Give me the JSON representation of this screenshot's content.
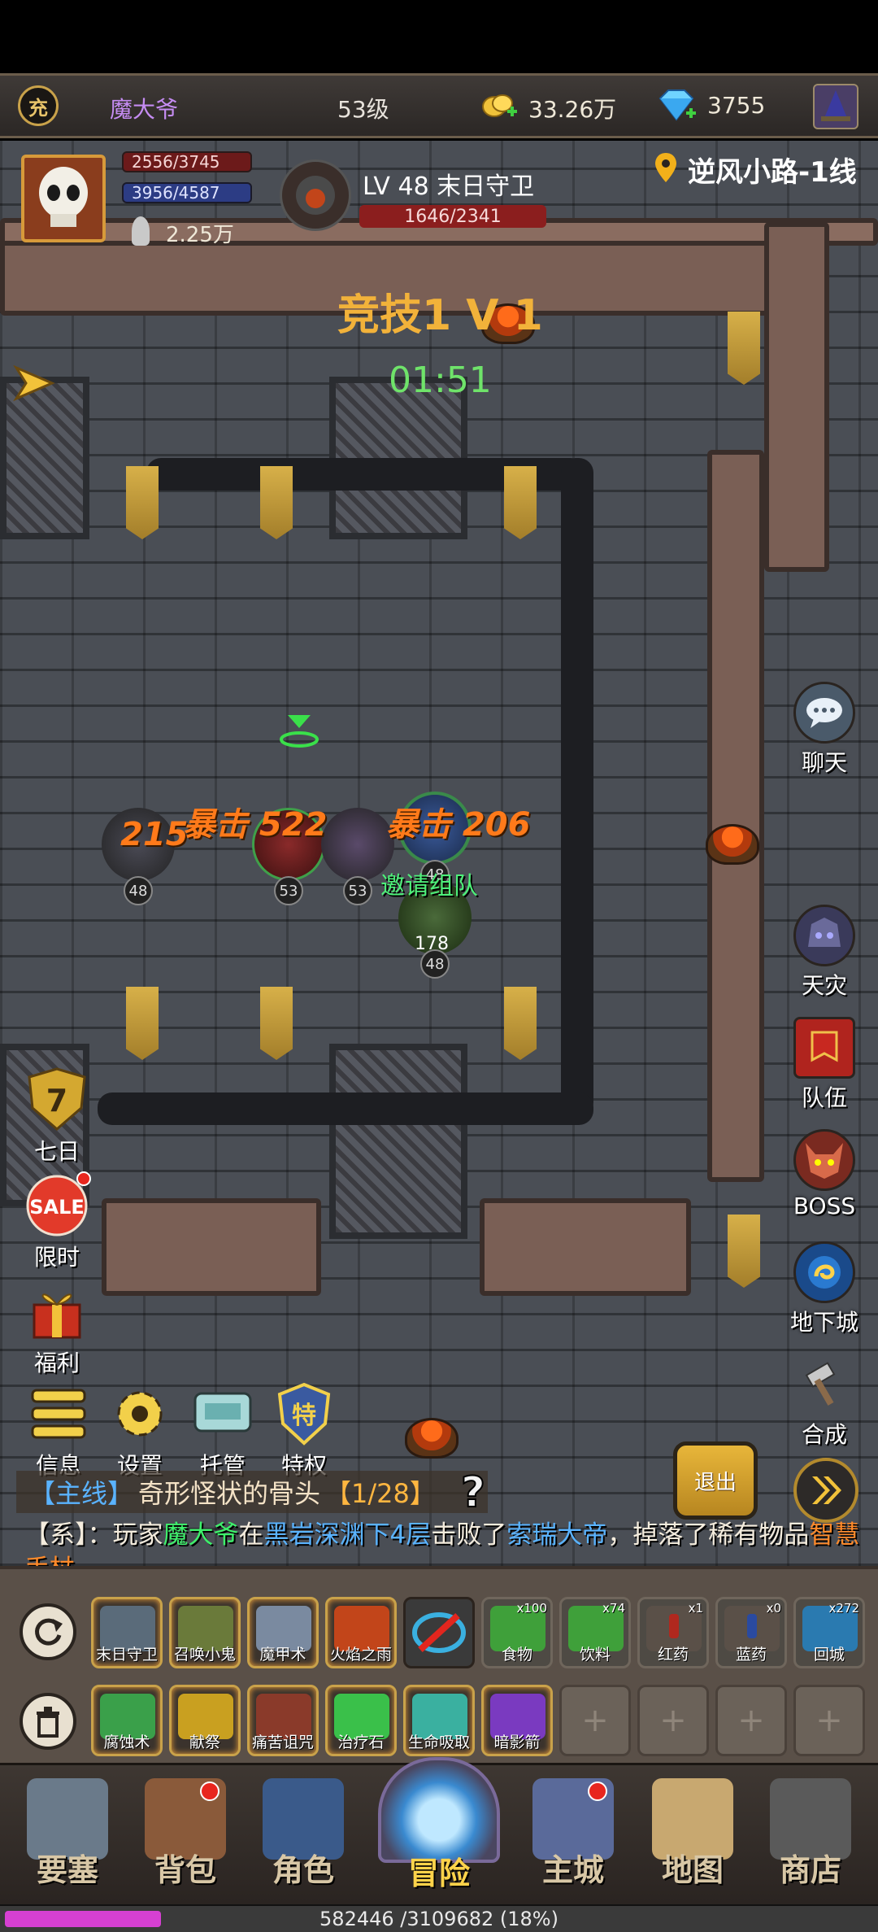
{
  "topbar": {
    "recharge_label": "充",
    "player_name": "魔大爷",
    "player_level": "53级",
    "gold": "33.26万",
    "gems": "3755"
  },
  "player": {
    "hp": "2556/3745",
    "mp": "3956/4587",
    "power": "2.25万"
  },
  "target": {
    "name": "LV 48 末日守卫",
    "hp": "1646/2341"
  },
  "location": "逆风小路-1线",
  "arena": {
    "title": "竞技1 V 1",
    "timer": "01:51",
    "invite": "邀请组队",
    "damage": [
      "215",
      "暴击 522",
      "暴击 206"
    ],
    "unit_levels": [
      "48",
      "53",
      "53",
      "48",
      "48"
    ],
    "enemy_hp_small": "178"
  },
  "right_buttons": [
    {
      "label": "聊天",
      "icon": "chat-icon"
    },
    {
      "label": "天灾",
      "icon": "skull-helm-icon"
    },
    {
      "label": "队伍",
      "icon": "team-flag-icon"
    },
    {
      "label": "BOSS",
      "icon": "demon-icon"
    },
    {
      "label": "地下城",
      "icon": "portal-icon"
    },
    {
      "label": "合成",
      "icon": "hammer-icon"
    }
  ],
  "left_buttons": [
    {
      "label": "七日",
      "icon": "seven-day-badge-icon",
      "badge": "7"
    },
    {
      "label": "限时",
      "icon": "sale-icon",
      "badge": "SALE"
    },
    {
      "label": "福利",
      "icon": "gift-icon"
    }
  ],
  "tools": [
    {
      "label": "信息",
      "icon": "menu-icon"
    },
    {
      "label": "设置",
      "icon": "gear-icon"
    },
    {
      "label": "托管",
      "icon": "auto-icon"
    },
    {
      "label": "特权",
      "icon": "privilege-icon",
      "badge": "特"
    }
  ],
  "quest": {
    "tag": "【主线】",
    "text": "奇形怪状的骨头",
    "progress": "【1/28】"
  },
  "system_message": {
    "prefix": "【系】：玩家",
    "player": "魔大爷",
    "at": "在",
    "place": "黑岩深渊下4层",
    "defeated": "击败了",
    "boss": "索瑞大帝",
    "dropped": "，掉落了稀有物品",
    "item": "智慧手杖"
  },
  "exit_label": "退出",
  "skills_row1": [
    {
      "label": "末日守卫",
      "color": "#5a6b7a"
    },
    {
      "label": "召唤小鬼",
      "color": "#6a7a3a"
    },
    {
      "label": "魔甲术",
      "color": "#7a8aa0"
    },
    {
      "label": "火焰之雨",
      "color": "#c2451a"
    }
  ],
  "items_row1": [
    {
      "label": "食物",
      "count": "x100",
      "color": "#3fa03a"
    },
    {
      "label": "饮料",
      "count": "x74",
      "color": "#3fa03a"
    },
    {
      "label": "红药",
      "count": "x1",
      "color": "#b0281e"
    },
    {
      "label": "蓝药",
      "count": "x0",
      "color": "#2a4aa0"
    },
    {
      "label": "回城",
      "count": "x272",
      "color": "#2a7ab0"
    }
  ],
  "skills_row2": [
    {
      "label": "腐蚀术",
      "color": "#3aa04a"
    },
    {
      "label": "献祭",
      "color": "#c9a020"
    },
    {
      "label": "痛苦诅咒",
      "color": "#8a3a2a"
    },
    {
      "label": "治疗石",
      "color": "#3ac04a"
    },
    {
      "label": "生命吸取",
      "color": "#3ab0a0"
    },
    {
      "label": "暗影箭",
      "color": "#7a3ac0"
    }
  ],
  "empty_slot": "+",
  "nav": [
    {
      "label": "要塞",
      "icon": "fortress-icon",
      "dot": false
    },
    {
      "label": "背包",
      "icon": "backpack-icon",
      "dot": true
    },
    {
      "label": "角色",
      "icon": "helmet-icon",
      "dot": false
    },
    {
      "label": "冒险",
      "icon": "portal-gate-icon",
      "dot": false,
      "active": true
    },
    {
      "label": "主城",
      "icon": "castle-icon",
      "dot": true
    },
    {
      "label": "地图",
      "icon": "scroll-map-icon",
      "dot": false
    },
    {
      "label": "商店",
      "icon": "shop-icon",
      "dot": false
    }
  ],
  "xp": {
    "text": "582446 /3109682 (18%)",
    "fraction": 0.18
  }
}
